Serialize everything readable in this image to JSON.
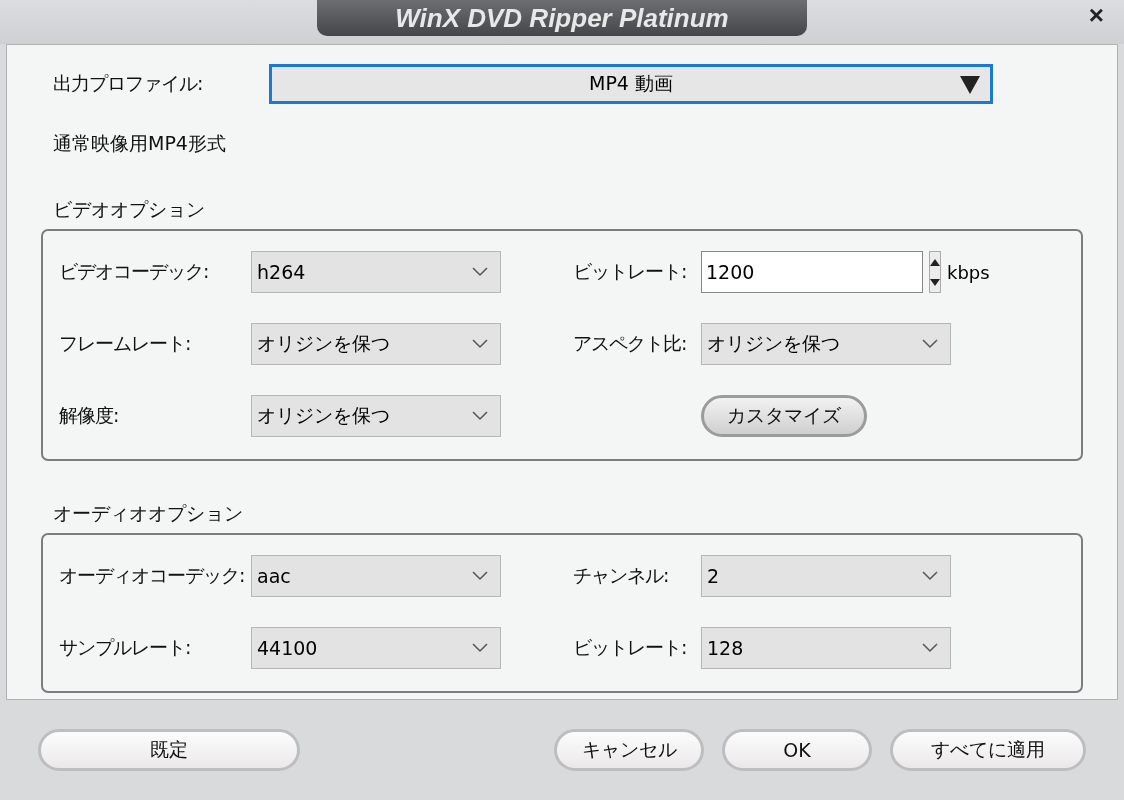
{
  "window": {
    "title": "WinX DVD Ripper Platinum",
    "close": "×"
  },
  "profile": {
    "label": "出力プロファイル:",
    "value": "MP4 動画"
  },
  "description": "通常映像用MP4形式",
  "sections": [
    {
      "title": "ビデオオプション",
      "fields": [
        {
          "label": "ビデオコーデック:",
          "kind": "select",
          "value": "h264"
        },
        {
          "label": "ビットレート:",
          "kind": "spin",
          "value": "1200",
          "unit": "kbps"
        },
        {
          "label": "フレームレート:",
          "kind": "select",
          "value": "オリジンを保つ"
        },
        {
          "label": "アスペクト比:",
          "kind": "select",
          "value": "オリジンを保つ"
        },
        {
          "label": "解像度:",
          "kind": "select",
          "value": "オリジンを保つ"
        },
        {
          "kind": "button",
          "value": "カスタマイズ"
        }
      ]
    },
    {
      "title": "オーディオオプション",
      "fields": [
        {
          "label": "オーディオコーデック:",
          "kind": "select",
          "value": "aac"
        },
        {
          "label": "チャンネル:",
          "kind": "select",
          "value": "2"
        },
        {
          "label": "サンプルレート:",
          "kind": "select",
          "value": "44100"
        },
        {
          "label": "ビットレート:",
          "kind": "select",
          "value": "128"
        }
      ]
    }
  ],
  "buttons": {
    "left": [
      "既定"
    ],
    "right": [
      "キャンセル",
      "OK",
      "すべてに適用"
    ]
  }
}
